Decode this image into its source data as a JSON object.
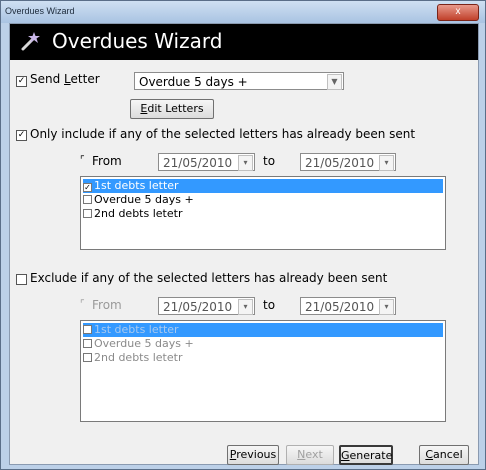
{
  "window": {
    "title": "Overdues Wizard",
    "close_label": "x"
  },
  "header": {
    "title": "Overdues Wizard"
  },
  "send_letter": {
    "checked": true,
    "label": "Send Letter",
    "selected": "Overdue 5 days +",
    "edit_button": "Edit Letters"
  },
  "include_section": {
    "checked": true,
    "label": "Only include if any of the selected letters has already been sent",
    "from_label": "From",
    "from_date": "21/05/2010",
    "to_label": "to",
    "to_date": "21/05/2010",
    "items": [
      {
        "label": "1st debts letter",
        "checked": true,
        "selected": true
      },
      {
        "label": "Overdue 5 days +",
        "checked": false,
        "selected": false
      },
      {
        "label": "2nd debts letetr",
        "checked": false,
        "selected": false
      }
    ]
  },
  "exclude_section": {
    "checked": false,
    "label": "Exclude if any of the selected letters has already been sent",
    "from_label": "From",
    "from_date": "21/05/2010",
    "to_label": "to",
    "to_date": "21/05/2010",
    "items": [
      {
        "label": "1st debts letter",
        "checked": false,
        "selected": true
      },
      {
        "label": "Overdue 5 days +",
        "checked": false,
        "selected": false
      },
      {
        "label": "2nd debts letetr",
        "checked": false,
        "selected": false
      }
    ]
  },
  "footer": {
    "previous": "Previous",
    "next": "Next",
    "generate": "Generate",
    "cancel": "Cancel"
  },
  "colors": {
    "highlight": "#3399ff",
    "header_bg": "#000000",
    "window_frame": "#bcd0e8"
  }
}
